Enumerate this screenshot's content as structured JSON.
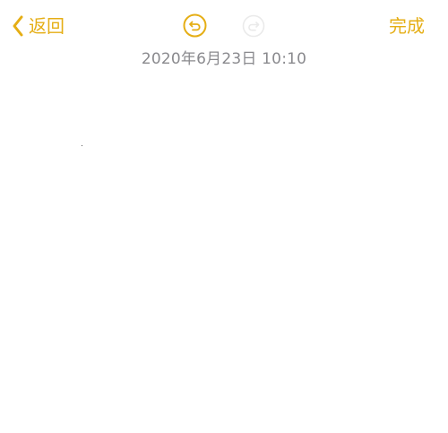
{
  "nav": {
    "back_label": "返回",
    "done_label": "完成",
    "back_icon": "chevron-left-icon",
    "undo_icon": "undo-icon",
    "redo_icon": "redo-icon"
  },
  "note": {
    "timestamp": "2020年6月23日 10:10",
    "content": ""
  },
  "colors": {
    "accent": "#E5AE15",
    "disabled": "#E8E8E8",
    "timestamp": "#8A8A8E",
    "background": "#FFFFFF"
  }
}
